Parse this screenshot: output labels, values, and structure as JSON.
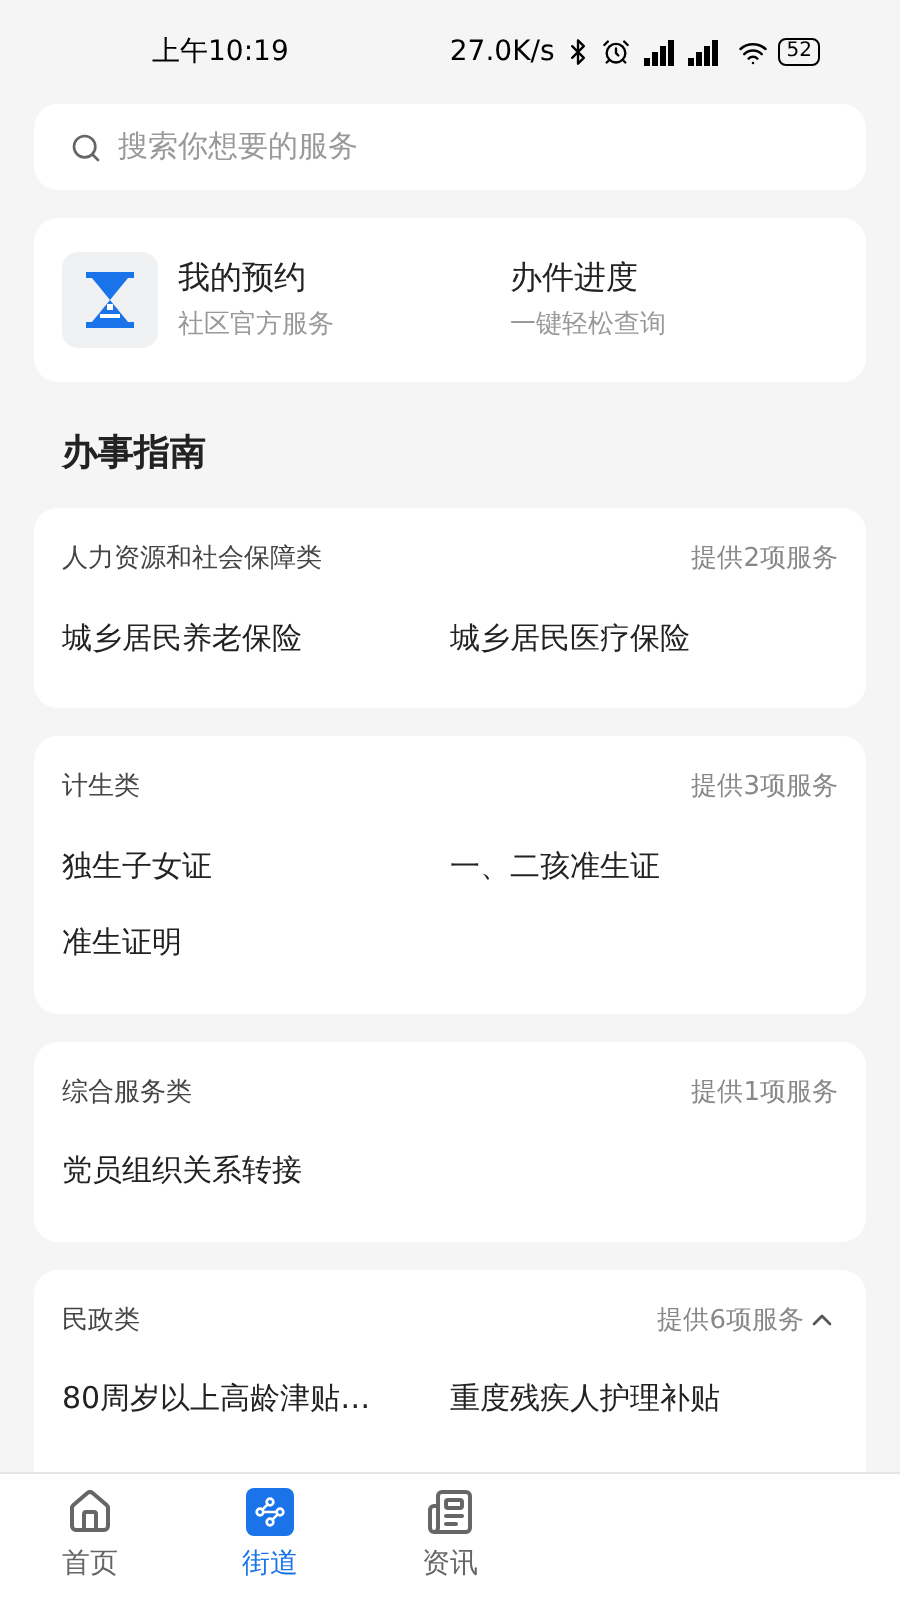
{
  "status_bar": {
    "time": "上午10:19",
    "speed": "27.0K/s",
    "battery": "52"
  },
  "search": {
    "placeholder": "搜索你想要的服务"
  },
  "quick": [
    {
      "kind": "icon",
      "title": "我的预约",
      "subtitle": "社区官方服务"
    },
    {
      "kind": "plain",
      "title": "办件进度",
      "subtitle": "一键轻松查询"
    }
  ],
  "section_title": "办事指南",
  "categories": [
    {
      "name": "人力资源和社会保障类",
      "count": "提供2项服务",
      "expanded": false,
      "services": [
        "城乡居民养老保险",
        "城乡居民医疗保险"
      ]
    },
    {
      "name": "计生类",
      "count": "提供3项服务",
      "expanded": false,
      "services": [
        "独生子女证",
        "一、二孩准生证",
        "准生证明"
      ]
    },
    {
      "name": "综合服务类",
      "count": "提供1项服务",
      "expanded": false,
      "services": [
        "党员组织关系转接"
      ]
    },
    {
      "name": "民政类",
      "count": "提供6项服务",
      "expanded": true,
      "services": [
        "80周岁以上高龄津贴…",
        "重度残疾人护理补贴"
      ]
    }
  ],
  "tabs": [
    {
      "label": "首页",
      "selected": false,
      "kind": "home"
    },
    {
      "label": "街道",
      "selected": true,
      "kind": "street"
    },
    {
      "label": "资讯",
      "selected": false,
      "kind": "news"
    }
  ]
}
